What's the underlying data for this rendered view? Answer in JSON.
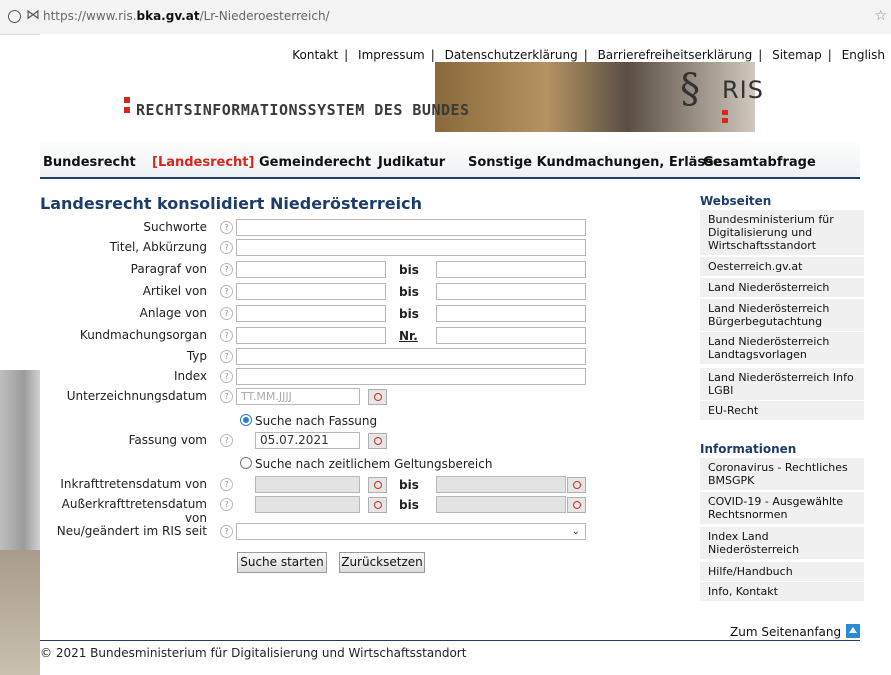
{
  "browser": {
    "url_prefix": "https://www.ris.",
    "url_domain": "bka.gv.at",
    "url_path": "/Lr-Niederoesterreich/"
  },
  "toplinks": [
    "Kontakt",
    "Impressum",
    "Datenschutzerklärung",
    "Barrierefreiheitserklärung",
    "Sitemap",
    "English"
  ],
  "logo": {
    "text": "RECHTSINFORMATIONSSYSTEM DES BUNDES",
    "ris": "RIS",
    "para": "§"
  },
  "nav": [
    "Bundesrecht",
    "[Landesrecht]",
    "Gemeinderecht",
    "Judikatur",
    "Sonstige Kundmachungen, Erlässe",
    "Gesamtabfrage"
  ],
  "heading": "Landesrecht konsolidiert Niederösterreich",
  "form": {
    "suchworte": "Suchworte",
    "titel": "Titel, Abkürzung",
    "paragraf": "Paragraf von",
    "artikel": "Artikel von",
    "anlage": "Anlage von",
    "kundmachungsorgan": "Kundmachungsorgan",
    "typ": "Typ",
    "index": "Index",
    "unterzeichnungsdatum": "Unterzeichnungsdatum",
    "date_placeholder": "TT.MM.JJJJ",
    "bis": "bis",
    "nr": "Nr.",
    "radio_fassung": "Suche nach Fassung",
    "fassung_vom": "Fassung vom",
    "fassung_value": "05.07.2021",
    "radio_geltung": "Suche nach zeitlichem Geltungsbereich",
    "inkraft": "Inkrafttretensdatum von",
    "ausserkraft": "Außerkrafttretensdatum von",
    "neu": "Neu/geändert im RIS seit",
    "search_button": "Suche starten",
    "reset_button": "Zurücksetzen"
  },
  "sidebar": {
    "webseiten_title": "Webseiten",
    "webseiten": [
      "Bundesministerium für Digitalisierung und Wirtschaftsstandort",
      "Oesterreich.gv.at",
      "Land Niederösterreich",
      "Land Niederösterreich Bürgerbegutachtung",
      "Land Niederösterreich Landtagsvorlagen",
      "Land Niederösterreich Info LGBl",
      "EU-Recht"
    ],
    "info_title": "Informationen",
    "informationen": [
      "Coronavirus - Rechtliches BMSGPK",
      "COVID-19 - Ausgewählte Rechtsnormen",
      "Index Land Niederösterreich",
      "Hilfe/Handbuch",
      "Info, Kontakt"
    ]
  },
  "to_top": "Zum Seitenanfang",
  "footer": "© 2021 Bundesministerium für Digitalisierung und Wirtschaftsstandort",
  "colors": {
    "accent": "#d9261c",
    "navy": "#1f3d6b",
    "link_blue": "#2a78d8"
  }
}
